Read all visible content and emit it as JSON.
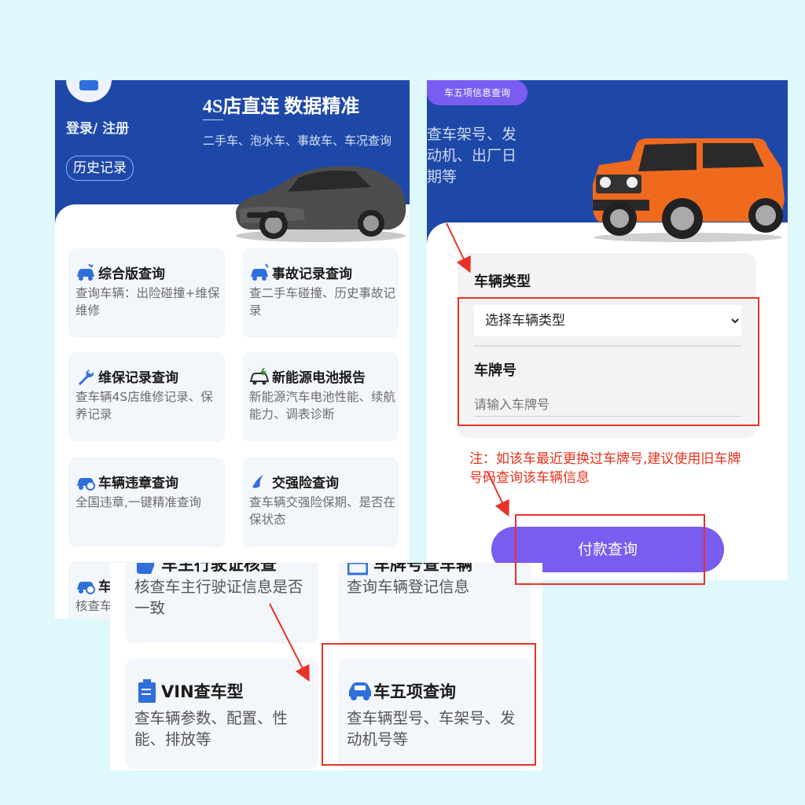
{
  "left": {
    "login": "登录/ 注册",
    "history": "历史记录",
    "slogan": "4S店直连 数据精准",
    "sub": "二手车、泡水车、事故车、车况查询",
    "cards": [
      {
        "title": "综合版查询",
        "desc": "查询车辆：出险碰撞+维保维修"
      },
      {
        "title": "事故记录查询",
        "desc": "查二手车碰撞、历史事故记录"
      },
      {
        "title": "维保记录查询",
        "desc": "查车辆4S店维修记录、保养记录"
      },
      {
        "title": "新能源电池报告",
        "desc": "新能源汽车电池性能、续航能力、调表诊断"
      },
      {
        "title": "车辆违章查询",
        "desc": "全国违章,一键精准查询"
      },
      {
        "title": "交强险查询",
        "desc": "查车辆交强险保期、是否在保状态"
      },
      {
        "title": "车",
        "desc": "核查车"
      }
    ]
  },
  "right": {
    "badge": "车五项信息查询",
    "desc": "查车架号、发动机、出厂日期等",
    "type_label": "车辆类型",
    "type_select": "选择车辆类型",
    "plate_label": "车牌号",
    "plate_placeholder": "请输入车牌号",
    "note": "注：如该车最近更换过车牌号,建议使用旧车牌号码查询该车辆信息",
    "pay": "付款查询"
  },
  "bottom": {
    "cards": [
      {
        "title": "车主行驶证核查",
        "desc": "核查车主行驶证信息是否一致"
      },
      {
        "title": "车牌号查车辆",
        "desc": "查询车辆登记信息"
      },
      {
        "title": "VIN查车型",
        "desc": "查车辆参数、配置、性能、排放等"
      },
      {
        "title": "车五项查询",
        "desc": "查车辆型号、车架号、发动机号等"
      }
    ]
  },
  "colors": {
    "brand_blue": "#1e48a8",
    "accent_purple": "#7a5cf0",
    "annotation_red": "#e63328"
  },
  "icons": [
    "user-avatar-icon",
    "car-search-icon",
    "car-crash-icon",
    "wrench-icon",
    "battery-car-icon",
    "shield-icon",
    "id-card-icon",
    "plate-icon",
    "clipboard-icon",
    "car-icon"
  ]
}
